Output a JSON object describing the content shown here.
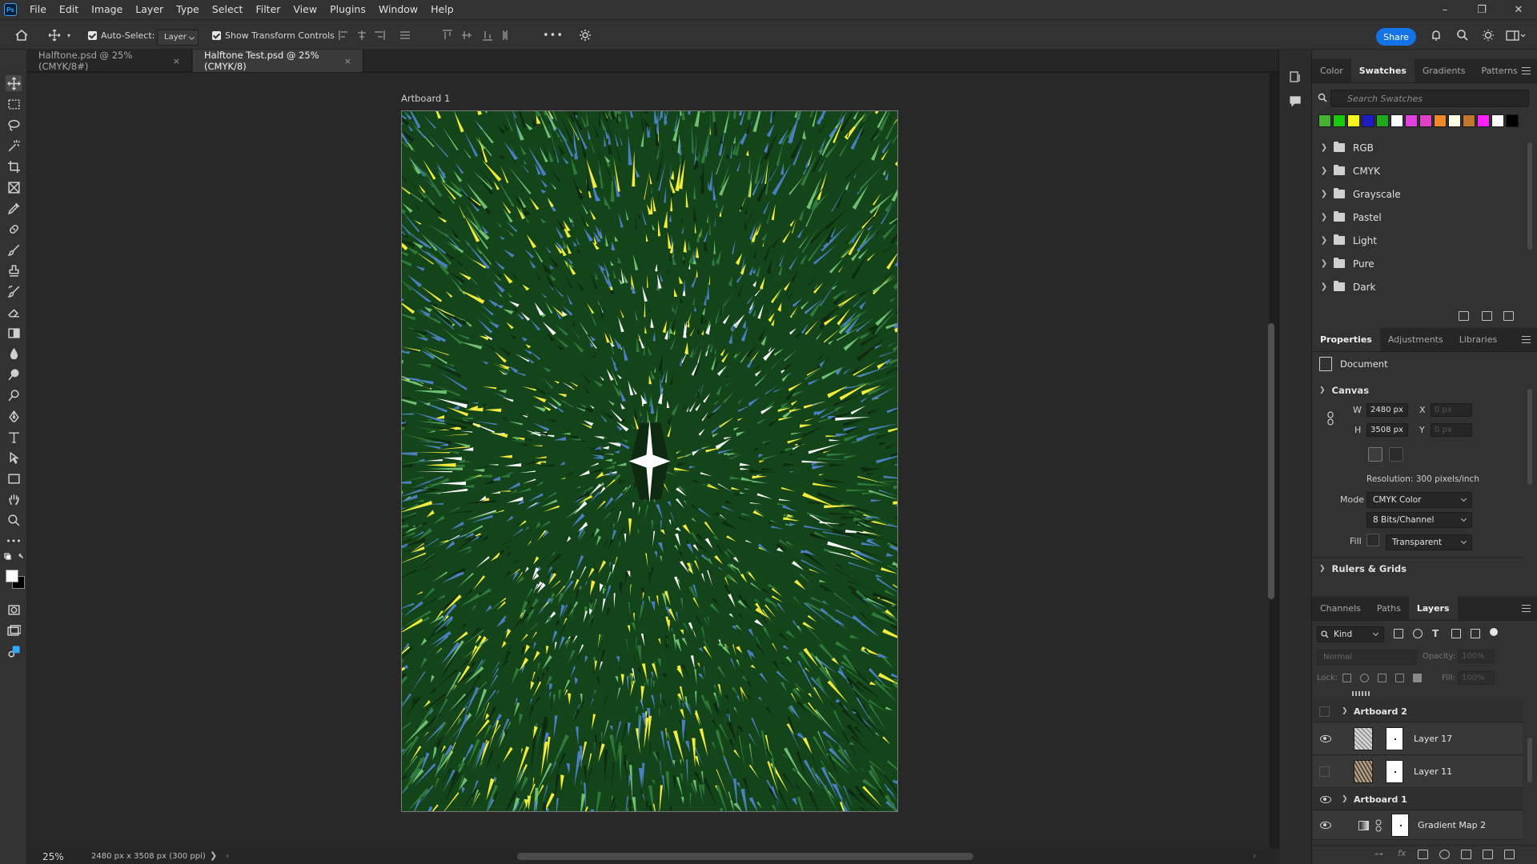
{
  "app": {
    "logo_text": "Ps"
  },
  "menu": [
    "File",
    "Edit",
    "Image",
    "Layer",
    "Type",
    "Select",
    "Filter",
    "View",
    "Plugins",
    "Window",
    "Help"
  ],
  "window_controls": {
    "minimize": "–",
    "restore": "❐",
    "close": "✕"
  },
  "options_bar": {
    "auto_select_label": "Auto-Select:",
    "auto_select_checked": true,
    "auto_select_target": "Layer",
    "show_transform_label": "Show Transform Controls",
    "show_transform_checked": true,
    "more_label": "•••",
    "share_label": "Share"
  },
  "tabs": [
    {
      "label": "Halftone.psd @ 25% (CMYK/8#)",
      "active": false
    },
    {
      "label": "Halftone Test.psd @ 25% (CMYK/8)",
      "active": true
    }
  ],
  "tab_close": "×",
  "canvas": {
    "artboard_label": "Artboard 1",
    "colors": {
      "bg": "#14451a",
      "green_dark": "#0e2a10",
      "green_mid": "#2f7a3a",
      "green_light": "#6fbf73",
      "blue": "#4a7fc1",
      "yellow": "#f4ec3c",
      "white": "#ffffff"
    }
  },
  "status": {
    "zoom": "25%",
    "doc_info": "2480 px x 3508 px (300 ppi)",
    "caret": "❯",
    "scroll_left": "‹",
    "scroll_right": "›"
  },
  "swatches_panel": {
    "tabs": [
      {
        "label": "Color",
        "active": false
      },
      {
        "label": "Swatches",
        "active": true
      },
      {
        "label": "Gradients",
        "active": false
      },
      {
        "label": "Patterns",
        "active": false
      }
    ],
    "search_placeholder": "Search Swatches",
    "colors": [
      "#46b035",
      "#19c80f",
      "#f5f51e",
      "#1c1cc0",
      "#1fa81f",
      "#ffffff",
      "#e040e0",
      "#e040c8",
      "#f08a28",
      "#ffffe6",
      "#c07830",
      "#ff20ff",
      "#ffffff",
      "#000000"
    ],
    "folders": [
      "RGB",
      "CMYK",
      "Grayscale",
      "Pastel",
      "Light",
      "Pure",
      "Dark"
    ]
  },
  "properties_panel": {
    "tabs": [
      {
        "label": "Properties",
        "active": true
      },
      {
        "label": "Adjustments",
        "active": false
      },
      {
        "label": "Libraries",
        "active": false
      }
    ],
    "document_label": "Document",
    "canvas_section": "Canvas",
    "w_label": "W",
    "w_value": "2480 px",
    "h_label": "H",
    "h_value": "3508 px",
    "x_label": "X",
    "x_value": "0 px",
    "y_label": "Y",
    "y_value": "0 px",
    "resolution": "Resolution: 300 pixels/inch",
    "mode_label": "Mode",
    "mode_value": "CMYK Color",
    "bits_value": "8 Bits/Channel",
    "fill_label": "Fill",
    "fill_value": "Transparent",
    "rulers_section": "Rulers & Grids"
  },
  "layers_panel": {
    "tabs": [
      {
        "label": "Channels",
        "active": false
      },
      {
        "label": "Paths",
        "active": false
      },
      {
        "label": "Layers",
        "active": true
      }
    ],
    "kind_label": "Kind",
    "blend_mode": "Normal",
    "opacity_label": "Opacity:",
    "opacity_value": "100%",
    "lock_label": "Lock:",
    "fill_label": "Fill:",
    "fill_value": "100%",
    "layers": [
      {
        "name": "Artboard 2",
        "type": "group",
        "visible": false
      },
      {
        "name": "Layer 17",
        "type": "layer",
        "visible": true
      },
      {
        "name": "Layer 11",
        "type": "layer",
        "visible": false
      },
      {
        "name": "Artboard 1",
        "type": "group",
        "visible": true
      },
      {
        "name": "Gradient Map 2",
        "type": "adjustment",
        "visible": true
      }
    ]
  }
}
